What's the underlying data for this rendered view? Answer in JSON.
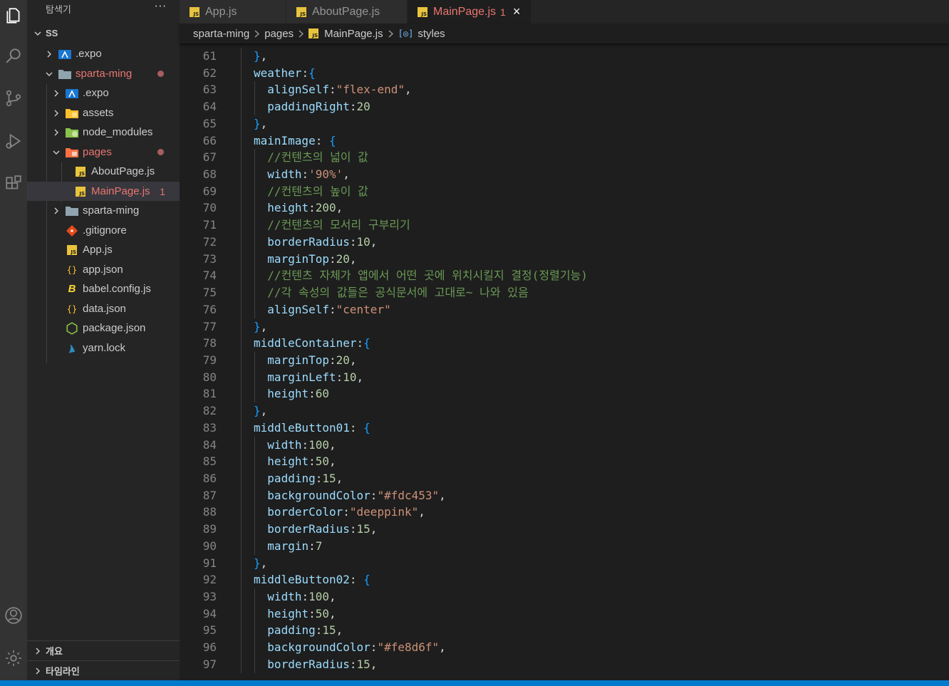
{
  "colors": {
    "activity_bar": "#333333",
    "sidebar": "#252526",
    "editor": "#1e1e1e",
    "status_bar": "#007acc",
    "modified": "#e9776f",
    "js_badge": "#e8c33d"
  },
  "activity_bar": {
    "icons": [
      "files-icon",
      "search-icon",
      "source-control-icon",
      "run-debug-icon",
      "extensions-icon",
      "account-icon",
      "settings-gear-icon"
    ]
  },
  "sidebar": {
    "title": "탐색기",
    "more": "···",
    "workspace": "SS",
    "tree": [
      {
        "label": ".expo",
        "icon": "expo-folder-icon",
        "expanded": false
      },
      {
        "label": "sparta-ming",
        "icon": "folder-open-icon",
        "expanded": true,
        "modified": true
      },
      {
        "label": ".expo",
        "icon": "expo-folder-icon",
        "expanded": false
      },
      {
        "label": "assets",
        "icon": "assets-folder-icon",
        "expanded": false
      },
      {
        "label": "node_modules",
        "icon": "node-folder-icon",
        "expanded": false
      },
      {
        "label": "pages",
        "icon": "pages-folder-icon",
        "expanded": true,
        "modified": true
      },
      {
        "label": "AboutPage.js",
        "icon": "js-icon"
      },
      {
        "label": "MainPage.js",
        "icon": "js-icon",
        "badge": "1",
        "selected": true
      },
      {
        "label": "sparta-ming",
        "icon": "folder-icon",
        "expanded": false
      },
      {
        "label": ".gitignore",
        "icon": "git-icon"
      },
      {
        "label": "App.js",
        "icon": "js-icon"
      },
      {
        "label": "app.json",
        "icon": "json-icon"
      },
      {
        "label": "babel.config.js",
        "icon": "babel-icon"
      },
      {
        "label": "data.json",
        "icon": "json-icon"
      },
      {
        "label": "package.json",
        "icon": "npm-icon"
      },
      {
        "label": "yarn.lock",
        "icon": "yarn-icon"
      }
    ],
    "outline": "개요",
    "timeline": "타임라인"
  },
  "tabs": [
    {
      "label": "App.js",
      "active": false
    },
    {
      "label": "AboutPage.js",
      "active": false
    },
    {
      "label": "MainPage.js",
      "active": true,
      "badge": "1",
      "close": "×"
    }
  ],
  "breadcrumb": {
    "items": [
      "sparta-ming",
      "pages",
      "MainPage.js",
      "styles"
    ]
  },
  "editor": {
    "lines": [
      {
        "num": "61",
        "indent": 0,
        "tokens": [
          [
            "b",
            "}"
          ],
          [
            "p",
            ","
          ]
        ]
      },
      {
        "num": "62",
        "indent": 0,
        "tokens": [
          [
            "k",
            "weather"
          ],
          [
            "p",
            ":"
          ],
          [
            "b",
            "{"
          ]
        ]
      },
      {
        "num": "63",
        "indent": 1,
        "tokens": [
          [
            "k",
            "alignSelf"
          ],
          [
            "p",
            ":"
          ],
          [
            "s",
            "\"flex-end\""
          ],
          [
            "p",
            ","
          ]
        ]
      },
      {
        "num": "64",
        "indent": 1,
        "tokens": [
          [
            "k",
            "paddingRight"
          ],
          [
            "p",
            ":"
          ],
          [
            "n",
            "20"
          ]
        ]
      },
      {
        "num": "65",
        "indent": 0,
        "tokens": [
          [
            "b",
            "}"
          ],
          [
            "p",
            ","
          ]
        ]
      },
      {
        "num": "66",
        "indent": 0,
        "tokens": [
          [
            "k",
            "mainImage"
          ],
          [
            "p",
            ": "
          ],
          [
            "b",
            "{"
          ]
        ]
      },
      {
        "num": "67",
        "indent": 1,
        "tokens": [
          [
            "c",
            "//컨텐츠의 넓이 값"
          ]
        ]
      },
      {
        "num": "68",
        "indent": 1,
        "tokens": [
          [
            "k",
            "width"
          ],
          [
            "p",
            ":"
          ],
          [
            "s",
            "'90%'"
          ],
          [
            "p",
            ","
          ]
        ]
      },
      {
        "num": "69",
        "indent": 1,
        "tokens": [
          [
            "c",
            "//컨텐츠의 높이 값"
          ]
        ]
      },
      {
        "num": "70",
        "indent": 1,
        "tokens": [
          [
            "k",
            "height"
          ],
          [
            "p",
            ":"
          ],
          [
            "n",
            "200"
          ],
          [
            "p",
            ","
          ]
        ]
      },
      {
        "num": "71",
        "indent": 1,
        "tokens": [
          [
            "c",
            "//컨텐츠의 모서리 구부리기"
          ]
        ]
      },
      {
        "num": "72",
        "indent": 1,
        "tokens": [
          [
            "k",
            "borderRadius"
          ],
          [
            "p",
            ":"
          ],
          [
            "n",
            "10"
          ],
          [
            "p",
            ","
          ]
        ]
      },
      {
        "num": "73",
        "indent": 1,
        "tokens": [
          [
            "k",
            "marginTop"
          ],
          [
            "p",
            ":"
          ],
          [
            "n",
            "20"
          ],
          [
            "p",
            ","
          ]
        ]
      },
      {
        "num": "74",
        "indent": 1,
        "tokens": [
          [
            "c",
            "//컨텐츠 자체가 앱에서 어떤 곳에 위치시킬지 결정(정렬기능)"
          ]
        ]
      },
      {
        "num": "75",
        "indent": 1,
        "tokens": [
          [
            "c",
            "//각 속성의 값들은 공식문서에 고대로~ 나와 있음"
          ]
        ]
      },
      {
        "num": "76",
        "indent": 1,
        "tokens": [
          [
            "k",
            "alignSelf"
          ],
          [
            "p",
            ":"
          ],
          [
            "s",
            "\"center\""
          ]
        ]
      },
      {
        "num": "77",
        "indent": 0,
        "tokens": [
          [
            "b",
            "}"
          ],
          [
            "p",
            ","
          ]
        ]
      },
      {
        "num": "78",
        "indent": 0,
        "tokens": [
          [
            "k",
            "middleContainer"
          ],
          [
            "p",
            ":"
          ],
          [
            "b",
            "{"
          ]
        ]
      },
      {
        "num": "79",
        "indent": 1,
        "tokens": [
          [
            "k",
            "marginTop"
          ],
          [
            "p",
            ":"
          ],
          [
            "n",
            "20"
          ],
          [
            "p",
            ","
          ]
        ]
      },
      {
        "num": "80",
        "indent": 1,
        "tokens": [
          [
            "k",
            "marginLeft"
          ],
          [
            "p",
            ":"
          ],
          [
            "n",
            "10"
          ],
          [
            "p",
            ","
          ]
        ]
      },
      {
        "num": "81",
        "indent": 1,
        "tokens": [
          [
            "k",
            "height"
          ],
          [
            "p",
            ":"
          ],
          [
            "n",
            "60"
          ]
        ]
      },
      {
        "num": "82",
        "indent": 0,
        "tokens": [
          [
            "b",
            "}"
          ],
          [
            "p",
            ","
          ]
        ]
      },
      {
        "num": "83",
        "indent": 0,
        "tokens": [
          [
            "k",
            "middleButton01"
          ],
          [
            "p",
            ": "
          ],
          [
            "b",
            "{"
          ]
        ]
      },
      {
        "num": "84",
        "indent": 1,
        "tokens": [
          [
            "k",
            "width"
          ],
          [
            "p",
            ":"
          ],
          [
            "n",
            "100"
          ],
          [
            "p",
            ","
          ]
        ]
      },
      {
        "num": "85",
        "indent": 1,
        "tokens": [
          [
            "k",
            "height"
          ],
          [
            "p",
            ":"
          ],
          [
            "n",
            "50"
          ],
          [
            "p",
            ","
          ]
        ]
      },
      {
        "num": "86",
        "indent": 1,
        "tokens": [
          [
            "k",
            "padding"
          ],
          [
            "p",
            ":"
          ],
          [
            "n",
            "15"
          ],
          [
            "p",
            ","
          ]
        ]
      },
      {
        "num": "87",
        "indent": 1,
        "tokens": [
          [
            "k",
            "backgroundColor"
          ],
          [
            "p",
            ":"
          ],
          [
            "s",
            "\"#fdc453\""
          ],
          [
            "p",
            ","
          ]
        ]
      },
      {
        "num": "88",
        "indent": 1,
        "tokens": [
          [
            "k",
            "borderColor"
          ],
          [
            "p",
            ":"
          ],
          [
            "s",
            "\"deeppink\""
          ],
          [
            "p",
            ","
          ]
        ]
      },
      {
        "num": "89",
        "indent": 1,
        "tokens": [
          [
            "k",
            "borderRadius"
          ],
          [
            "p",
            ":"
          ],
          [
            "n",
            "15"
          ],
          [
            "p",
            ","
          ]
        ]
      },
      {
        "num": "90",
        "indent": 1,
        "tokens": [
          [
            "k",
            "margin"
          ],
          [
            "p",
            ":"
          ],
          [
            "n",
            "7"
          ]
        ]
      },
      {
        "num": "91",
        "indent": 0,
        "tokens": [
          [
            "b",
            "}"
          ],
          [
            "p",
            ","
          ]
        ]
      },
      {
        "num": "92",
        "indent": 0,
        "tokens": [
          [
            "k",
            "middleButton02"
          ],
          [
            "p",
            ": "
          ],
          [
            "b",
            "{"
          ]
        ]
      },
      {
        "num": "93",
        "indent": 1,
        "tokens": [
          [
            "k",
            "width"
          ],
          [
            "p",
            ":"
          ],
          [
            "n",
            "100"
          ],
          [
            "p",
            ","
          ]
        ]
      },
      {
        "num": "94",
        "indent": 1,
        "tokens": [
          [
            "k",
            "height"
          ],
          [
            "p",
            ":"
          ],
          [
            "n",
            "50"
          ],
          [
            "p",
            ","
          ]
        ]
      },
      {
        "num": "95",
        "indent": 1,
        "tokens": [
          [
            "k",
            "padding"
          ],
          [
            "p",
            ":"
          ],
          [
            "n",
            "15"
          ],
          [
            "p",
            ","
          ]
        ]
      },
      {
        "num": "96",
        "indent": 1,
        "tokens": [
          [
            "k",
            "backgroundColor"
          ],
          [
            "p",
            ":"
          ],
          [
            "s",
            "\"#fe8d6f\""
          ],
          [
            "p",
            ","
          ]
        ]
      },
      {
        "num": "97",
        "indent": 1,
        "tokens": [
          [
            "k",
            "borderRadius"
          ],
          [
            "p",
            ":"
          ],
          [
            "n",
            "15"
          ],
          [
            "p",
            ","
          ]
        ]
      }
    ]
  }
}
